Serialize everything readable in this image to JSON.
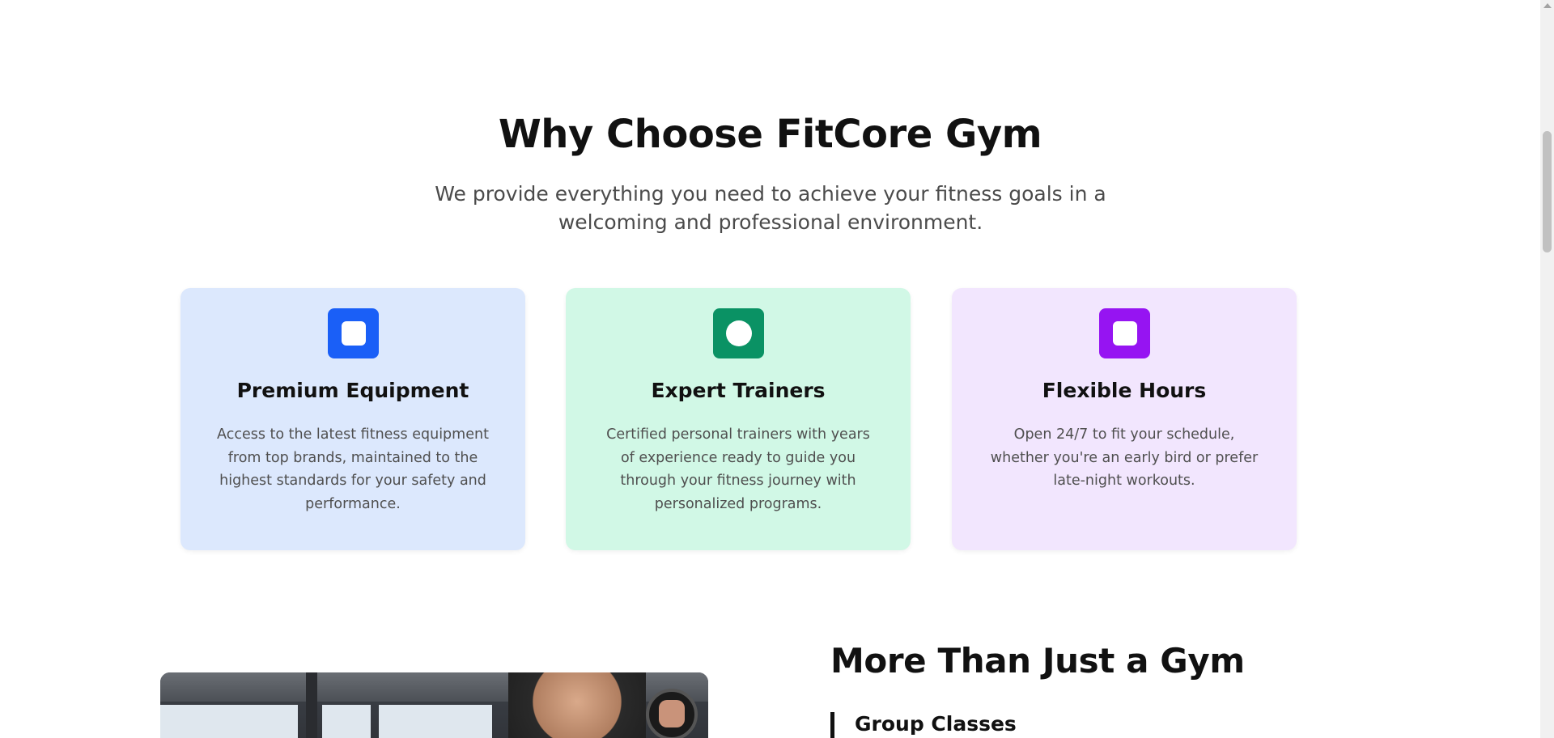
{
  "why_section": {
    "title": "Why Choose FitCore Gym",
    "subtitle": "We provide everything you need to achieve your fitness goals in a welcoming and professional environment."
  },
  "features": [
    {
      "title": "Premium Equipment",
      "description": "Access to the latest fitness equipment from top brands, maintained to the highest standards for your safety and performance.",
      "icon": "square-icon",
      "accent": "#1a5ff7",
      "background": "#dce8fd"
    },
    {
      "title": "Expert Trainers",
      "description": "Certified personal trainers with years of experience ready to guide you through your fitness journey with personalized programs.",
      "icon": "circle-icon",
      "accent": "#0a9264",
      "background": "#d1f8e6"
    },
    {
      "title": "Flexible Hours",
      "description": "Open 24/7 to fit your schedule, whether you're an early bird or prefer late-night workouts.",
      "icon": "square-icon",
      "accent": "#9614f2",
      "background": "#f2e6fe"
    }
  ],
  "more_section": {
    "title": "More Than Just a Gym",
    "first_item": "Group Classes"
  }
}
